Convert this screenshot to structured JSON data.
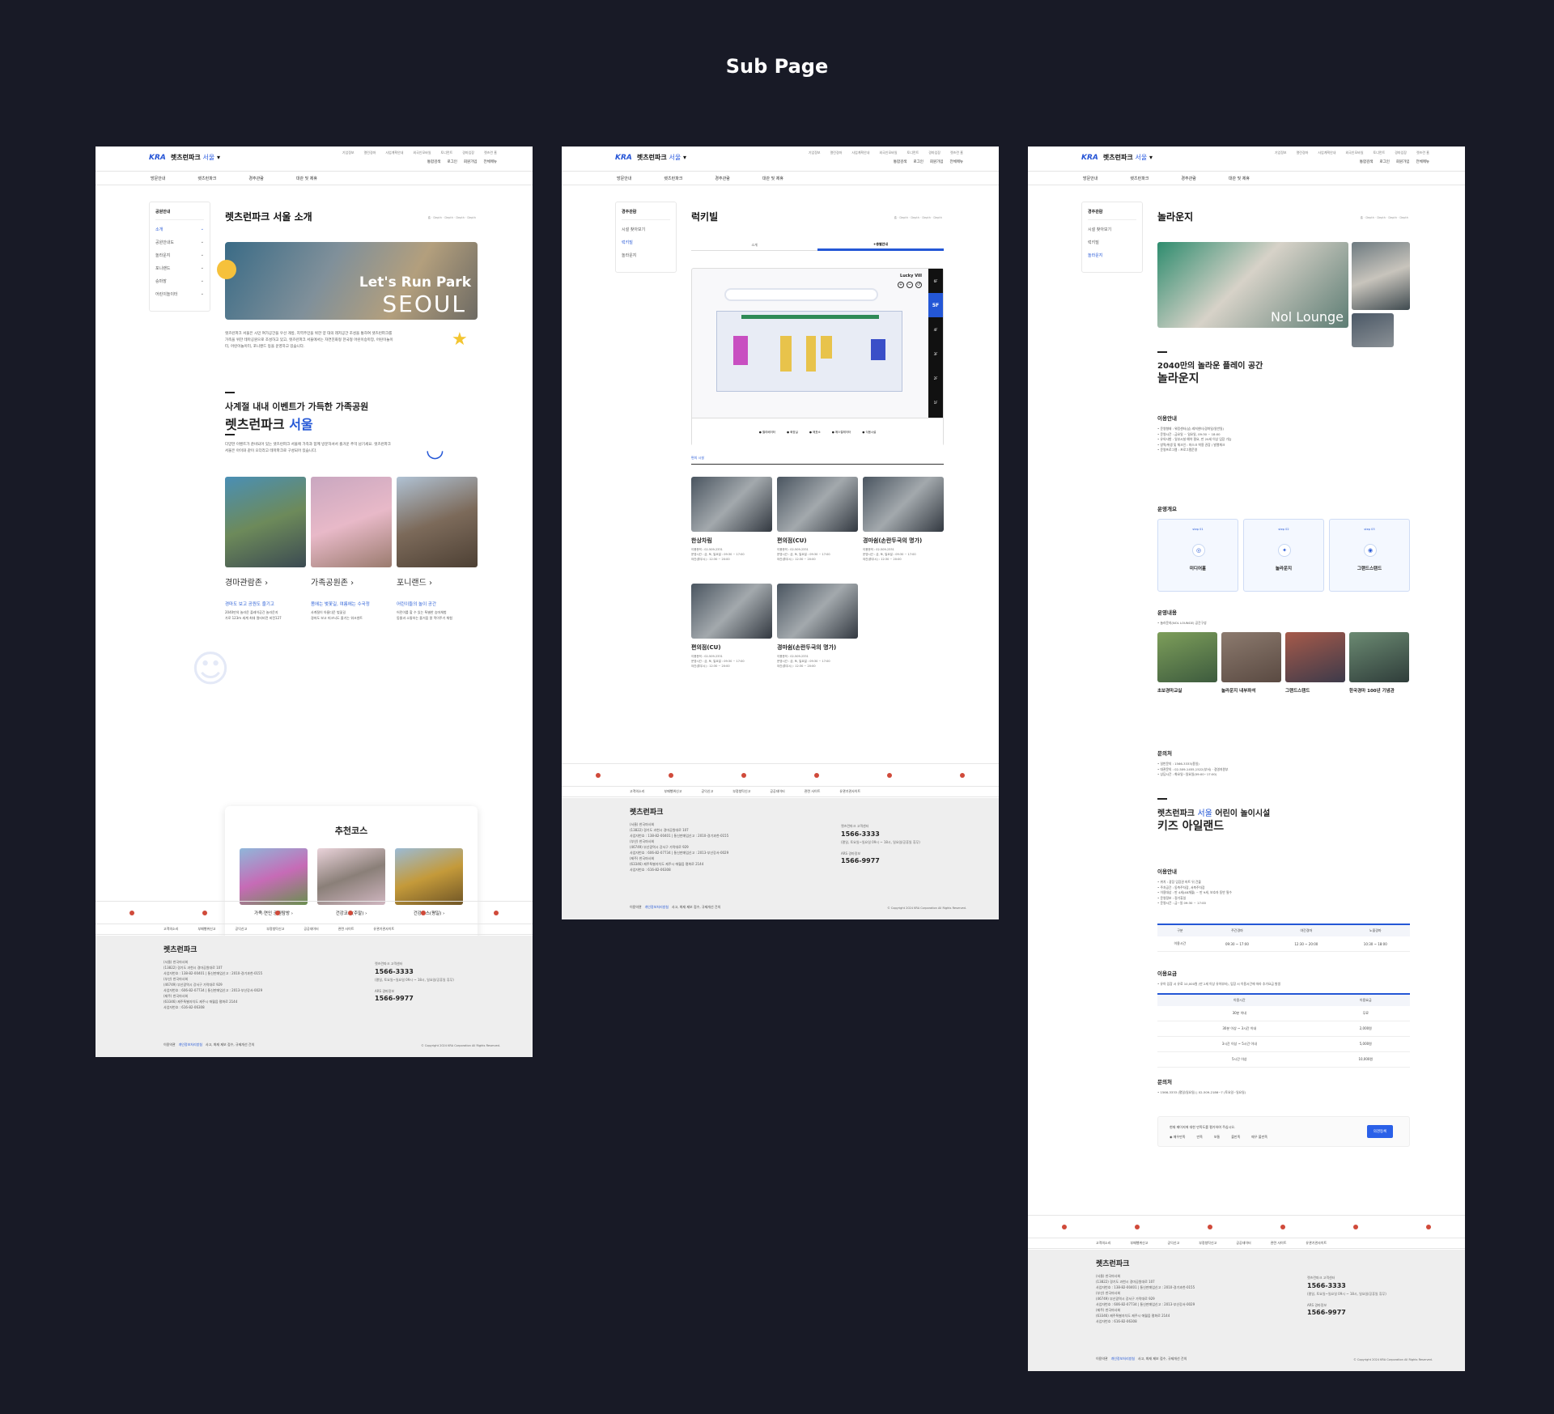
{
  "heading": "Sub Page",
  "header": {
    "logo_kra": "KRA",
    "logo_park": "렛츠런파크",
    "logo_city": "서울",
    "util_links": [
      "기업정보",
      "열린경마",
      "사업계획안내",
      "외국인모바일",
      "토너먼트",
      "경마입장",
      "렛츠런 홈"
    ],
    "util_buttons": [
      "통합검색",
      "로그인",
      "회원가입",
      "전체메뉴"
    ],
    "gnb": [
      "방문안내",
      "렛츠런파크",
      "경주관람",
      "대관 및 제휴"
    ]
  },
  "page1": {
    "lnb_title": "공원안내",
    "lnb_items": [
      "소개",
      "공원안내도",
      "놀라운지",
      "포니랜드",
      "승마장",
      "어린이놀이터"
    ],
    "title": "렛츠런파크 서울 소개",
    "breadcrumb": "홈 · Depth · Depth · Depth · Depth",
    "hero_line1": "Let's Run Park",
    "hero_line2": "SEOUL",
    "intro": "렛츠런파크 서울은 시민 여가공간을 우선 개방, 지역주민을 위한 양 대의 레저공간 조성을 통하여 렛츠런파크를 가족을 위한 테마공원으로 조성하고 있고, 렛츠런파크 서울에서는 자연친화형 한국형 어린이승마장, 어린이놀이터, 어린이놀이터, 포니랜드 등을 운영하고 있습니다.",
    "section_title_1": "사계절 내내 이벤트가 가득한 가족공원",
    "section_title_2a": "렛츠런파크",
    "section_title_2b": "서울",
    "section_desc": "다양한 이벤트가 준비되어 있는 렛츠런파크 서울에 가족과 함께 방문하셔서 즐거운 추억 남기세요. 렛츠런파크 서울은 아이와 같이 오더라고 테마파크로 구성되어 있습니다.",
    "cards": [
      {
        "name": "경마관람존",
        "sub": "경마도 보고 공원도 즐기고",
        "lines": [
          "2040만의 놀라운 플레이공간 놀라운지",
          "가로 123m 세계 최대 멀티비전 비전127"
        ]
      },
      {
        "name": "가족공원존",
        "sub": "봄에는 벚꽃길, 여름에는 수국정",
        "lines": [
          "사계절이 아름다운 벚꽃길",
          "경마도 보고 피크닉도 즐기는 워크센트"
        ]
      },
      {
        "name": "포니랜드",
        "sub": "어린이들의 놀이 공간",
        "lines": [
          "어린이를 할 수 있는 특별한 승마체험",
          "동물과 소통하는 즐거움 말 먹이주기 체험"
        ]
      }
    ],
    "rec_title": "추천코스",
    "rec_items": [
      "가족·연인 공원탐방",
      "건강코스(주말)",
      "건강코스(평일)"
    ],
    "survey_q": "현재 페이지에 대한 만족도를 평가하여 주십시오.",
    "survey_opts": [
      "매우만족",
      "만족",
      "보통",
      "불만족",
      "매우 불만족"
    ],
    "survey_btn": "의견등록"
  },
  "page2": {
    "lnb_title": "경주관람",
    "lnb_items": [
      "시설 찾아보기",
      "럭키빌",
      "놀라운지"
    ],
    "title": "럭키빌",
    "tabs": [
      "소개",
      "층별안내"
    ],
    "map_label": "Lucky Vill",
    "floors": [
      "6F",
      "5F",
      "4F",
      "3F",
      "2F",
      "1F"
    ],
    "legend": [
      "엘리베이터",
      "화장실",
      "매표소",
      "에스컬레이터",
      "식음시설"
    ],
    "section_label": "편의 시설",
    "stores": [
      {
        "name": "한상차림",
        "phone": "이용문의 : 02-509-2331",
        "hours": "운영시간 : 금, 토, 일요일 : 09:30 ~ 17:00",
        "extra": "야간(휴무시) : 12:30 ~ 20:00"
      },
      {
        "name": "편의점(CU)",
        "phone": "이용문의 : 02-509-2331",
        "hours": "운영시간 : 금, 토, 일요일 : 09:30 ~ 17:00",
        "extra": "야간(휴무시) : 12:30 ~ 20:00"
      },
      {
        "name": "경마쉼(손란두국의 명가)",
        "phone": "이용문의 : 02-509-2331",
        "hours": "운영시간 : 금, 토, 일요일 : 09:30 ~ 17:00",
        "extra": "야간(휴무시) : 12:30 ~ 20:00"
      },
      {
        "name": "편의점(CU)",
        "phone": "이용문의 : 02-509-2331",
        "hours": "운영시간 : 금, 토, 일요일 : 09:30 ~ 17:00",
        "extra": "야간(휴무시) : 12:30 ~ 20:00"
      },
      {
        "name": "경마쉼(손란두국의 명가)",
        "phone": "이용문의 : 02-509-2331",
        "hours": "운영시간 : 금, 토, 일요일 : 09:30 ~ 17:00",
        "extra": "야간(휴무시) : 12:30 ~ 20:00"
      }
    ]
  },
  "page3": {
    "lnb_title": "경주관람",
    "lnb_items": [
      "시설 찾아보기",
      "럭키빌",
      "놀라운지"
    ],
    "title": "놀라운지",
    "hero_text": "Nol Lounge",
    "headline1": "2040만의 놀라운 플레이 공간",
    "headline2": "놀라운지",
    "usage_title": "이용안내",
    "usage_lines": [
      "운영형태 : 워킹센터(남) 레저센터(경마일/일반일)",
      "운영시간 : 금요일 ~ 일요일, 09:30 ~ 18:00",
      "유의사항 : 일부시설 예약 필요, 만 20세 이상 입장 가능",
      "방역/위생 및 체크인 : 마스크 착용 권장 / 발열체크",
      "운영프로그램 : 프로그램운영"
    ],
    "ops_title": "운영개요",
    "ops": [
      {
        "step": "step 01",
        "name": "미디어홀"
      },
      {
        "step": "step 02",
        "name": "놀라운지"
      },
      {
        "step": "step 03",
        "name": "그랜드스탠드"
      }
    ],
    "content_title": "운영내용",
    "content_sub": "놀라운지(NOL LOUNGE) 공간구성",
    "content_items": [
      "초보경마교실",
      "놀라운지 내부좌석",
      "그랜드스탠드",
      "한국경마 100년 기념관"
    ],
    "contact_title": "문의처",
    "contact_lines": [
      "일반문의 : 1566-3333(종일)",
      "대관문의 : 02-509-1455,1522(부서) · 경영지원부",
      "상담시간 : 화요일~일요일(09:00~17:00)"
    ],
    "kids_pre_a": "렛츠런파크",
    "kids_pre_b": "서울",
    "kids_pre_c": "어린이 놀이시설",
    "kids_title": "키즈 아일랜드",
    "kids_usage_title": "이용안내",
    "kids_usage_lines": [
      "위치 : 광장 입장권 마트 뒤 건물",
      "주차공간 : 동측주차장, 서측주차장",
      "이용대상 : 만 4세(48개월) ~ 만 9세, 보호자 동반 필수",
      "운영정보 : 정기휴일",
      "운영시간 : 금~일 09:30 ~ 17:00"
    ],
    "hours_table": {
      "headers": [
        "구분",
        "주간경마",
        "야간경마",
        "노을경마"
      ],
      "row_label": "이용시간",
      "row": [
        "09:30 ~ 17:00",
        "12:30 ~ 20:00",
        "10:30 ~ 18:00"
      ]
    },
    "fee_title": "이용요금",
    "fee_note": "유아 입장 시 유료 10,000원 (만 2세 이상 유아부터), 입장 시 이용시간에 따라 추가요금 발생",
    "fee_table": {
      "headers": [
        "이용시간",
        "이용요금"
      ],
      "rows": [
        [
          "30분 이내",
          "무료"
        ],
        [
          "30분 이상 ~ 3시간 이내",
          "2,000원"
        ],
        [
          "3시간 이상 ~ 5시간 이내",
          "5,000원"
        ],
        [
          "5시간 이상",
          "10,000원"
        ]
      ]
    },
    "kids_contact_title": "문의처",
    "kids_contact_line": "1566-3333 (평일/일요일) | 02-509-2186~7 (토요일~일요일)"
  },
  "footer": {
    "links": [
      "고객의소리",
      "부패행위신고",
      "공익신고",
      "부정청탁신고",
      "공공데이터",
      "관련 사이트",
      "유관기관사이트"
    ],
    "name": "렛츠런파크",
    "addr": [
      "(서울) 한국마사회",
      "(13822) 경기도 과천시 경마공원대로 107",
      "사업자번호 : 138-82-00401 | 통신판매업신고 : 2010-경기과천-0155",
      "(부산) 한국마사회",
      "(46749) 부산광역시 강서구 가락대로 929",
      "사업자번호 : 606-82-07734 | 통신판매업신고 : 2013-부산강서-0029",
      "(제주) 한국마사회",
      "(63346) 제주특별자치도 제주시 애월읍 평화로 2144",
      "사업자번호 : 616-82-06308"
    ],
    "cs_label": "렛츠런파크 고객센터",
    "cs_phone": "1566-3333",
    "cs_hours": "(평일, 토요일~일요일 09시 ~ 18시, 일요일/공휴일 휴무)",
    "ars_label": "ARS 경마정보",
    "ars_phone": "1566-9977",
    "bottom": [
      "이용약관",
      "개인정보처리방침",
      "사고, 화재 제보 접수, 규제개선 건의"
    ],
    "copy": "© Copyright 2024 KRA Corporation All Rights Reserved."
  }
}
